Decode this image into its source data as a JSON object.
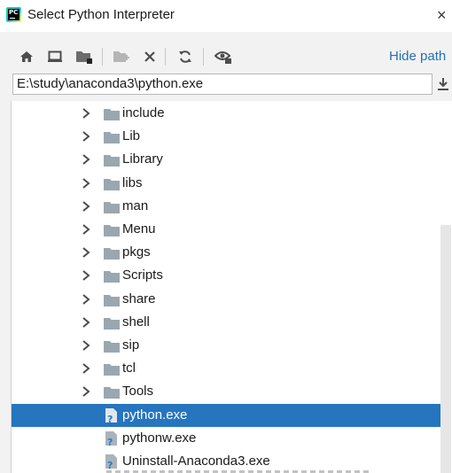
{
  "window": {
    "title": "Select Python Interpreter",
    "icon": "pycharm-icon",
    "close": "×"
  },
  "toolbar": {
    "buttons": [
      "home-icon",
      "desktop-icon",
      "project-folder-icon",
      "new-folder-icon",
      "delete-icon",
      "refresh-icon",
      "show-hidden-icon"
    ],
    "hide_path": "Hide path"
  },
  "path": {
    "value": "E:\\study\\anaconda3\\python.exe"
  },
  "tree": {
    "items": [
      {
        "label": "include",
        "type": "folder"
      },
      {
        "label": "Lib",
        "type": "folder"
      },
      {
        "label": "Library",
        "type": "folder"
      },
      {
        "label": "libs",
        "type": "folder"
      },
      {
        "label": "man",
        "type": "folder"
      },
      {
        "label": "Menu",
        "type": "folder"
      },
      {
        "label": "pkgs",
        "type": "folder"
      },
      {
        "label": "Scripts",
        "type": "folder"
      },
      {
        "label": "share",
        "type": "folder"
      },
      {
        "label": "shell",
        "type": "folder"
      },
      {
        "label": "sip",
        "type": "folder"
      },
      {
        "label": "tcl",
        "type": "folder"
      },
      {
        "label": "Tools",
        "type": "folder"
      },
      {
        "label": "python.exe",
        "type": "file",
        "selected": true
      },
      {
        "label": "pythonw.exe",
        "type": "file"
      },
      {
        "label": "Uninstall-Anaconda3.exe",
        "type": "file"
      }
    ]
  },
  "colors": {
    "selection": "#2675bf",
    "link": "#2470b3",
    "folder": "#9aa7b0"
  }
}
